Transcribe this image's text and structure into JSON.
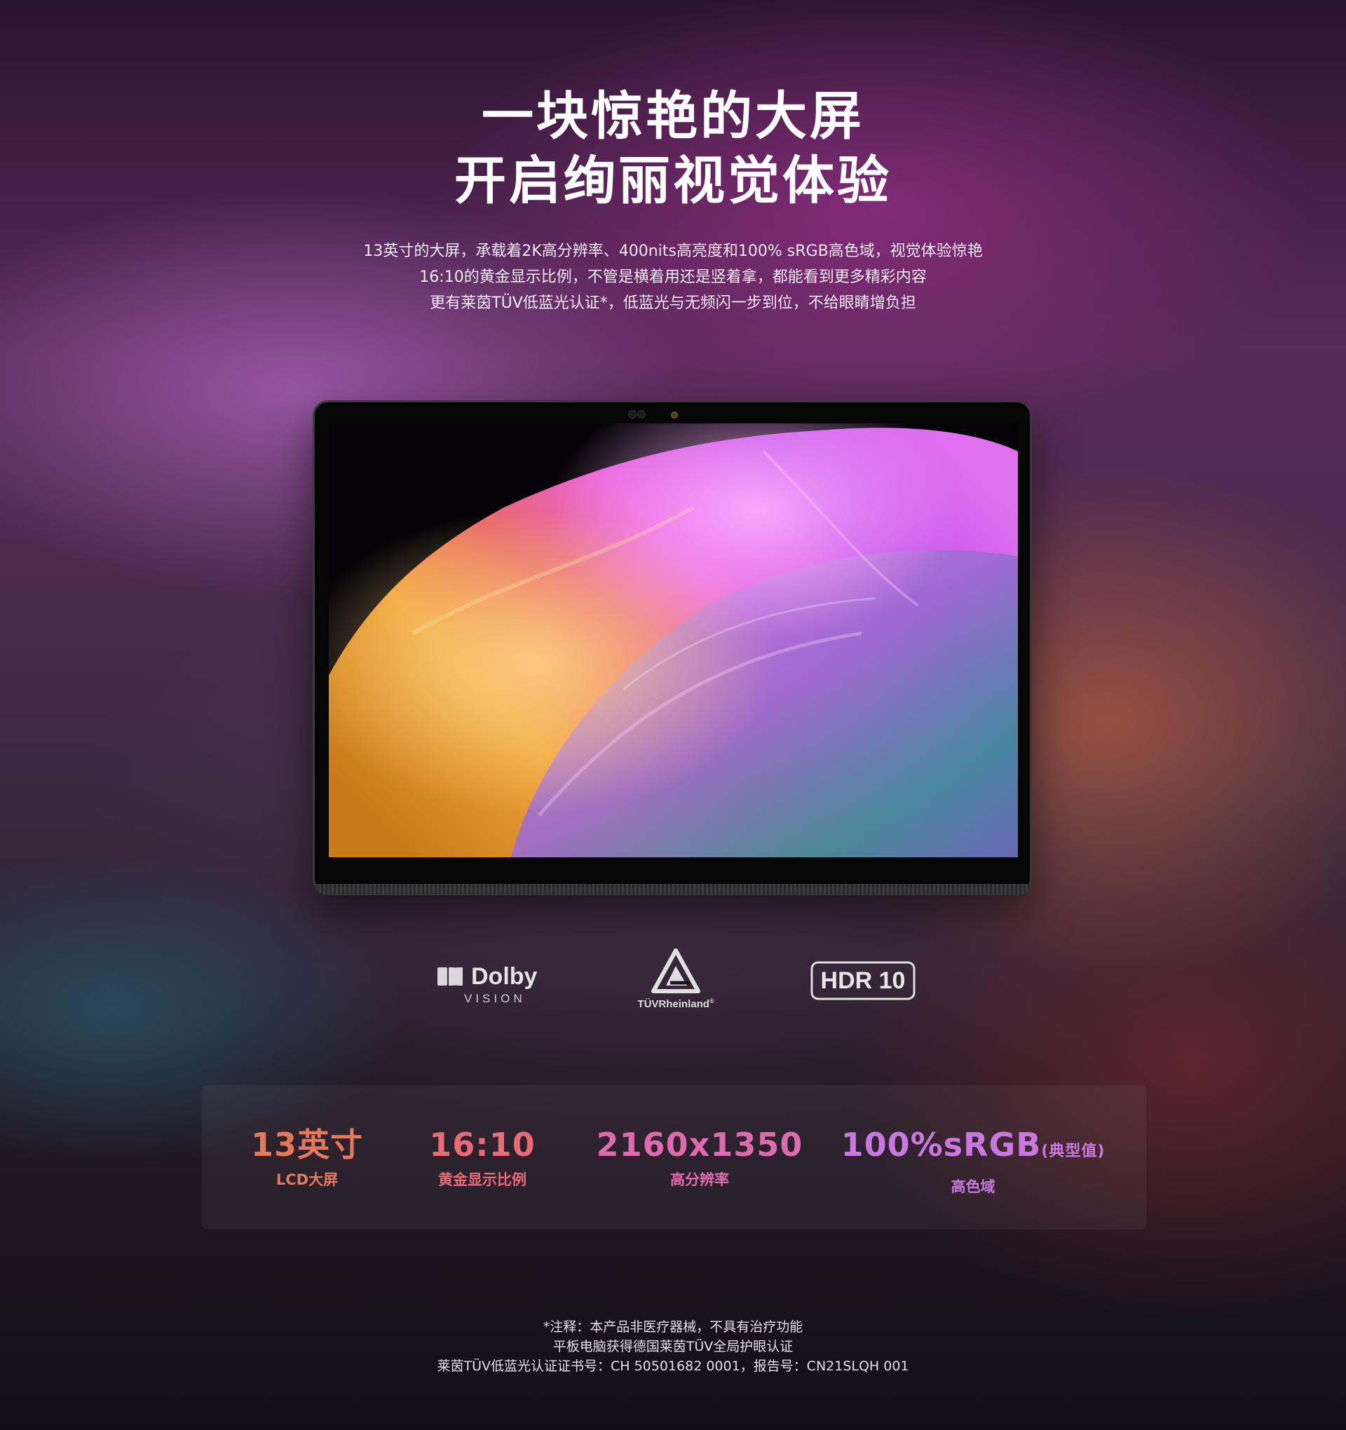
{
  "headline": {
    "line1": "一块惊艳的大屏",
    "line2": "开启绚丽视觉体验"
  },
  "description": {
    "line1": "13英寸的大屏，承载着2K高分辨率、400nits高亮度和100% sRGB高色域，视觉体验惊艳",
    "line2": "16:10的黄金显示比例，不管是横着用还是竖着拿，都能看到更多精彩内容",
    "line3": "更有莱茵TÜV低蓝光认证*，低蓝光与无频闪一步到位，不给眼睛增负担"
  },
  "logos": {
    "dolby": {
      "name": "Dolby",
      "sub": "VISION"
    },
    "tuv": {
      "name": "TÜVRheinland",
      "mark": "®"
    },
    "hdr": {
      "name": "HDR 10"
    }
  },
  "specs": [
    {
      "value": "13英寸",
      "suffix": "",
      "label": "LCD大屏",
      "color": "#e7785a"
    },
    {
      "value": "16:10",
      "suffix": "",
      "label": "黄金显示比例",
      "color": "#ea6a78"
    },
    {
      "value": "2160x1350",
      "suffix": "",
      "label": "高分辨率",
      "color": "#e06ab0"
    },
    {
      "value": "100%sRGB",
      "suffix": "(典型值)",
      "label": "高色域",
      "color": "#c978e0"
    }
  ],
  "notes": {
    "line1": "*注释：本产品非医疗器械，不具有治疗功能",
    "line2": "平板电脑获得德国莱茵TÜV全局护眼认证",
    "line3": "莱茵TÜV低蓝光认证证书号：CH 50501682 0001，报告号：CN21SLQH 001"
  }
}
